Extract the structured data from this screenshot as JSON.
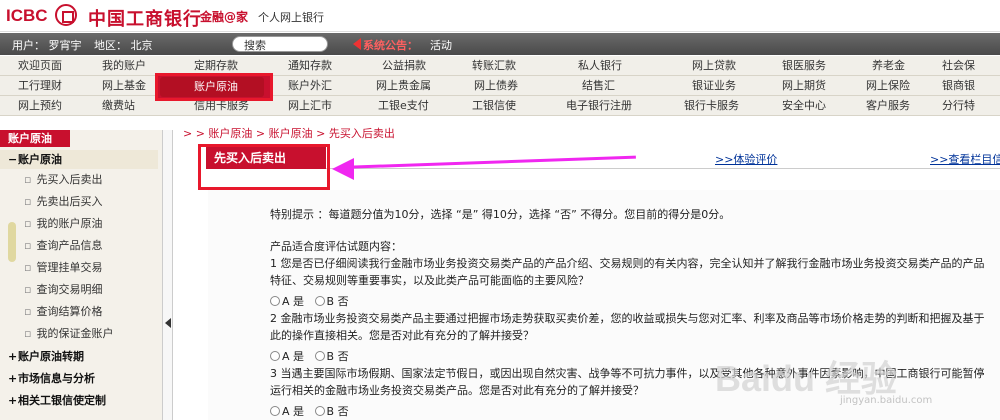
{
  "header": {
    "logo_en": "ICBC",
    "logo_cn": "中国工商银行",
    "brand": "金融@家",
    "subbrand": "个人网上银行"
  },
  "userbar": {
    "user": "用户：   罗宵宇",
    "region": "地区：   北京",
    "search_placeholder": "搜索",
    "notice_label": "系统公告：",
    "notice_text": "活动"
  },
  "nav": {
    "rows": [
      [
        "欢迎页面",
        "我的账户",
        "定期存款",
        "通知存款",
        "公益捐款",
        "转账汇款",
        "私人银行",
        "网上贷款",
        "银医服务",
        "养老金",
        "社会保"
      ],
      [
        "工行理财",
        "网上基金",
        "账户原油",
        "账户外汇",
        "网上贵金属",
        "网上债券",
        "结售汇",
        "银证业务",
        "网上期货",
        "网上保险",
        "银商银"
      ],
      [
        "网上预约",
        "缴费站",
        "信用卡服务",
        "网上汇市",
        "工银e支付",
        "工银信使",
        "电子银行注册",
        "银行卡服务",
        "安全中心",
        "客户服务",
        "分行特"
      ]
    ],
    "active": "账户原油"
  },
  "sidebar": {
    "header": "账户原油",
    "section_open": "账户原油",
    "items": [
      "先买入后卖出",
      "先卖出后买入",
      "我的账户原油",
      "查询产品信息",
      "管理挂单交易",
      "查询交易明细",
      "查询结算价格",
      "我的保证金账户"
    ],
    "sections_closed": [
      "账户原油转期",
      "市场信息与分析",
      "相关工银信使定制"
    ]
  },
  "content": {
    "breadcrumb": "> > 账户原油 > 账户原油 > 先买入后卖出",
    "title": "先买入后卖出",
    "link1": ">>体验评价",
    "link2": ">>查看栏目信息",
    "tip": "特别提示 ：每道题分值为10分，选择 “是” 得10分，选择 “否” 不得分。您目前的得分是0分。",
    "q_title": "产品适合度评估试题内容：",
    "q1_line1": "1 您是否已仔细阅读我行金融市场业务投资交易类产品的产品介绍、交易规则的有关内容，完全认知并了解我行金融市场业务投资交易类产品的产品",
    "q1_line2": "特征、交易规则等重要事实，以及此类产品可能面临的主要风险？",
    "q2_line1": "2 金融市场业务投资交易类产品主要通过把握市场走势获取买卖价差，您的收益或损失与您对汇率、利率及商品等市场价格走势的判断和把握及基于",
    "q2_line2": "此的操作直接相关。您是否对此有充分的了解并接受？",
    "q3_line1": "3 当遇主要国际市场假期、国家法定节假日，或因出现自然灾害、战争等不可抗力事件，以及受其他各种意外事件因素影响，中国工商银行可能暂停",
    "q3_line2": "运行相关的金融市场业务投资交易类产品。您是否对此有充分的了解并接受？",
    "opt_a": "A 是",
    "opt_b": "B 否"
  },
  "watermark": {
    "main": "Baidu 经验",
    "sub": "jingyan.baidu.com"
  }
}
